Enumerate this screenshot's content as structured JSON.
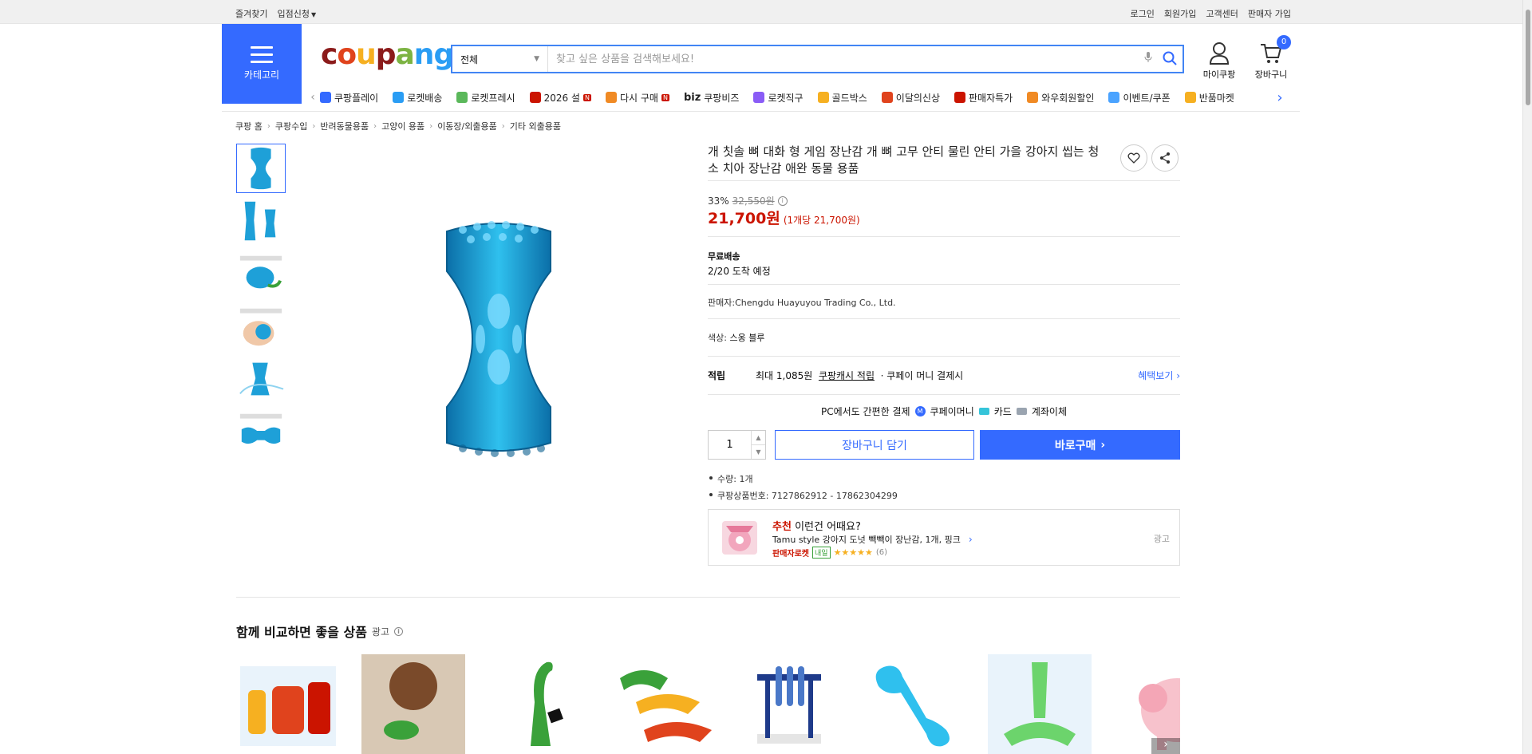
{
  "topbar": {
    "left": [
      "즐겨찾기",
      "입점신청"
    ],
    "right": [
      "로그인",
      "회원가입",
      "고객센터",
      "판매자 가입"
    ]
  },
  "header": {
    "category_label": "카테고리",
    "logo": "coupang",
    "search": {
      "scope": "전체",
      "placeholder": "찾고 싶은 상품을 검색해보세요!"
    },
    "mycoupang": "마이쿠팡",
    "cart": {
      "label": "장바구니",
      "count": "0"
    },
    "nav": [
      {
        "label": "쿠팡플레이",
        "color": "#346aff"
      },
      {
        "label": "로켓배송",
        "color": "#2a9df4"
      },
      {
        "label": "로켓프레시",
        "color": "#5bb85b"
      },
      {
        "label": "2026 설",
        "color": "#cb1400",
        "badge": "N"
      },
      {
        "label": "다시 구매",
        "color": "#f08a24",
        "badge": "N"
      },
      {
        "label": "쿠팡비즈",
        "color": "#222222",
        "prefix": "biz"
      },
      {
        "label": "로켓직구",
        "color": "#8a5cf6"
      },
      {
        "label": "골드박스",
        "color": "#f6b021"
      },
      {
        "label": "이달의신상",
        "color": "#e0431d"
      },
      {
        "label": "판매자특가",
        "color": "#cb1400"
      },
      {
        "label": "와우회원할인",
        "color": "#f08a24"
      },
      {
        "label": "이벤트/쿠폰",
        "color": "#4aa3ff"
      },
      {
        "label": "반품마켓",
        "color": "#f6b021"
      }
    ]
  },
  "breadcrumbs": [
    "쿠팡 홈",
    "쿠팡수입",
    "반려동물용품",
    "고양이 용품",
    "이동장/외출용품",
    "기타 외출용품"
  ],
  "product": {
    "title": "개 칫솔 뼈 대화 형 게임 장난감 개 뼈 고무 안티 물린 안티 가을 강아지 씹는 청소 치아 장난감 애완 동물 용품",
    "discount": "33%",
    "original_price": "32,550원",
    "price": "21,700원",
    "unit_price": "(1개당 21,700원)",
    "shipping_label": "무료배송",
    "arrival": "2/20 도착 예정",
    "seller": "판매자:Chengdu Huayuyou Trading Co., Ltd.",
    "color_label": "색상:",
    "color_value": "스옹 블루",
    "reward": {
      "label": "적립",
      "text_prefix": "최대 1,085원",
      "link": "쿠팡캐시 적립",
      "suffix": "· 쿠페이 머니 결제시",
      "benefit": "혜택보기"
    },
    "pc_pay": {
      "label": "PC에서도 간편한 결제",
      "methods": [
        "쿠페이머니",
        "카드",
        "계좌이체"
      ]
    },
    "quantity": "1",
    "cart_button": "장바구니 담기",
    "buy_button": "바로구매",
    "details": [
      "수량: 1개",
      "쿠팡상품번호: 7127862912 - 17862304299"
    ],
    "thumbnail_count": 6
  },
  "recommend": {
    "prefix": "추천",
    "heading": "이런건 어때요?",
    "name": "Tamu style 강아지 도넛 빽빽이 장난감, 1개, 핑크",
    "seller_tag": "판매자로켓",
    "delivery_tag": "내일",
    "rating": 5,
    "review_count": "(6)",
    "ad_label": "광고"
  },
  "compare": {
    "title": "함께 비교하면 좋을 상품",
    "ad_label": "광고",
    "items": [
      "sauce-bottle-toys",
      "poodle-with-toy",
      "green-dinosaur-toy",
      "rubber-chickens",
      "tube-stand",
      "blue-bone-toy",
      "green-brush-toy",
      "pink-pig-toy"
    ]
  },
  "colors": {
    "accent": "#346aff",
    "price_red": "#cb1400",
    "toy_blue": "#1ea0d8"
  }
}
